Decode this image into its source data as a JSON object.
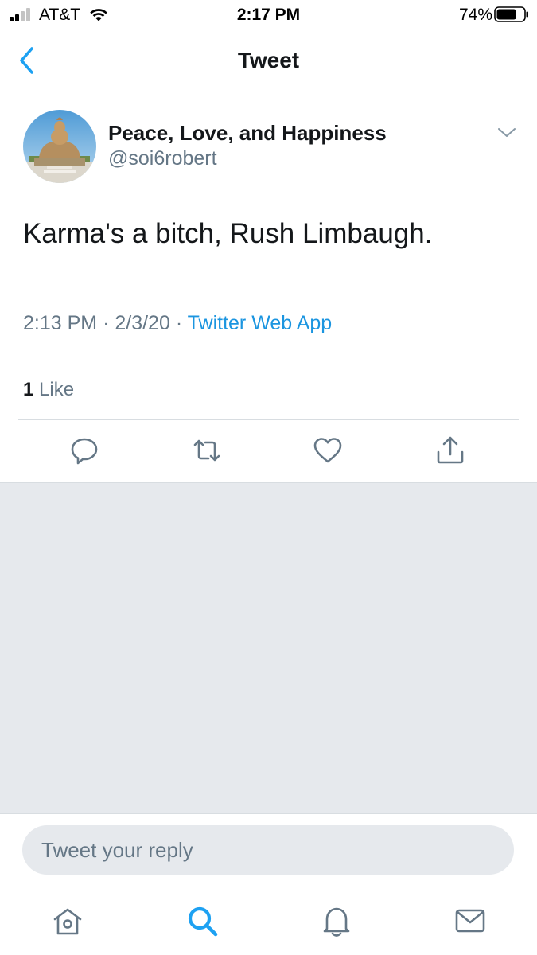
{
  "status_bar": {
    "carrier": "AT&T",
    "time": "2:17 PM",
    "battery_percent": "74%",
    "battery_level": 0.74,
    "signal_bars": 2
  },
  "nav": {
    "title": "Tweet",
    "back_icon": "chevron-left-icon"
  },
  "tweet": {
    "display_name": "Peace, Love, and Happiness",
    "handle": "@soi6robert",
    "text": "Karma's a bitch, Rush Limbaugh.",
    "time": "2:13 PM",
    "date": "2/3/20",
    "separator": "·",
    "source": "Twitter Web App",
    "like_count": "1",
    "like_label": "Like",
    "actions": [
      "reply-icon",
      "retweet-icon",
      "like-icon",
      "share-icon"
    ]
  },
  "reply": {
    "placeholder": "Tweet your reply"
  },
  "tab_bar": {
    "items": [
      "home-icon",
      "search-icon",
      "notifications-icon",
      "messages-icon"
    ],
    "active": "search-icon"
  },
  "colors": {
    "accent": "#1da1f2",
    "link": "#1b95e0",
    "secondary_text": "#657786",
    "icon": "#657786",
    "background_gray": "#e6e9ed"
  }
}
